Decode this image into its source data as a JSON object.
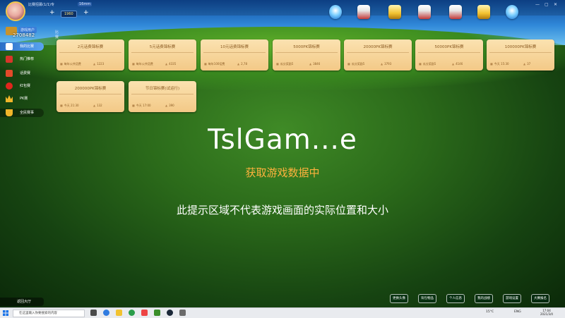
{
  "window": {
    "title": "比赛招募(1/1)专",
    "badge": "16mm",
    "username": "游戏用户",
    "user_id": "2708482",
    "coin_value": "1960",
    "controls": [
      "—",
      "▢",
      "✕"
    ]
  },
  "top_icons": [
    {
      "name": "mail-icon"
    },
    {
      "name": "store-icon"
    },
    {
      "name": "rank-icon"
    },
    {
      "name": "gift-icon"
    },
    {
      "name": "event-icon"
    },
    {
      "name": "trophy-icon"
    },
    {
      "name": "service-icon"
    }
  ],
  "sidebar": {
    "tab_label": "比赛",
    "items": [
      {
        "label": "我的比赛",
        "icon": "home-icon",
        "state": "active"
      },
      {
        "label": "热门推荐",
        "icon": "gift-box-icon",
        "state": ""
      },
      {
        "label": "话费赛",
        "icon": "gift-box-icon",
        "state": ""
      },
      {
        "label": "红包赛",
        "icon": "apple-icon",
        "state": ""
      },
      {
        "label": "PK赛",
        "icon": "crown-icon",
        "state": ""
      },
      {
        "label": "全民赛事",
        "icon": "cup-icon",
        "state": "dark"
      }
    ],
    "bottom_label": "返回大厅"
  },
  "cards": [
    {
      "title": "2元话费锦标赛",
      "left": "每年公共话费",
      "right": "1223"
    },
    {
      "title": "5元话费锦标赛",
      "left": "每年公共话费",
      "right": "4335"
    },
    {
      "title": "10元话费锦标赛",
      "left": "每年100话费",
      "right": "2,78"
    },
    {
      "title": "5000PK锦标赛",
      "left": "瓜分奖励5",
      "right": "3846"
    },
    {
      "title": "20000PK锦标赛",
      "left": "瓜分奖励5",
      "right": "3793"
    },
    {
      "title": "50000PK锦标赛",
      "left": "瓜分奖励5",
      "right": "4146"
    },
    {
      "title": "100000PK锦标赛",
      "left": "今天 15:30",
      "right": "37"
    },
    {
      "title": "200000PK锦标赛",
      "left": "今天 21:30",
      "right": "132"
    },
    {
      "title": "节日锦标赛(试运行)",
      "left": "今天 17:00",
      "right": "390"
    }
  ],
  "overlay": {
    "app_title": "TslGam...e",
    "loading_text": "获取游戏数据中",
    "notice_text": "此提示区域不代表游戏画面的实际位置和大小"
  },
  "bottom_buttons": [
    "更换头像",
    "背包物品",
    "个人信息",
    "我的战绩",
    "游戏设置",
    "大赛报名"
  ],
  "taskbar": {
    "search_placeholder": "在这里输入你要搜索的内容",
    "weather": "15°C",
    "lang": "ENG",
    "time": "17:04",
    "date": "2021/3/4"
  }
}
